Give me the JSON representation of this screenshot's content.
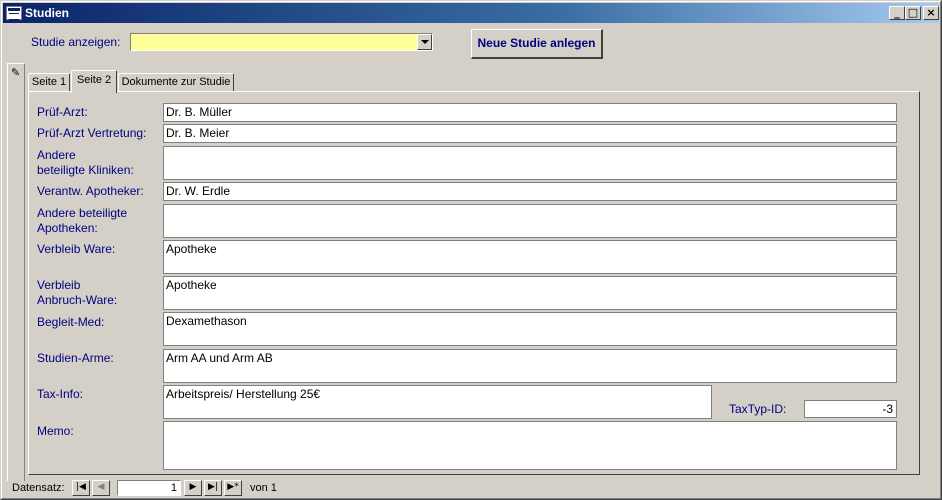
{
  "window": {
    "title": "Studien"
  },
  "titlebar_buttons": {
    "minimize": "_",
    "maximize": "□",
    "close": "×"
  },
  "header": {
    "studie_label": "Studie anzeigen:",
    "studie_value": "",
    "new_button": "Neue Studie anlegen"
  },
  "tabs": [
    {
      "label": "Seite 1"
    },
    {
      "label": "Seite 2",
      "active": true
    },
    {
      "label": "Dokumente zur Studie"
    }
  ],
  "fields": {
    "pruef_arzt": {
      "label": "Prüf-Arzt:",
      "value": "Dr. B. Müller"
    },
    "pruef_arzt_vertretung": {
      "label": "Prüf-Arzt Vertretung:",
      "value": "Dr. B. Meier"
    },
    "andere_kliniken": {
      "label1": "Andere",
      "label2": "beteiligte Kliniken:",
      "value": ""
    },
    "apotheker": {
      "label": "Verantw. Apotheker:",
      "value": "Dr. W. Erdle"
    },
    "andere_apotheken": {
      "label1": "Andere beteiligte",
      "label2": "Apotheken:",
      "value": ""
    },
    "verbleib_ware": {
      "label": "Verbleib Ware:",
      "value": "Apotheke"
    },
    "verbleib_anbruch": {
      "label1": "Verbleib",
      "label2": "Anbruch-Ware:",
      "value": "Apotheke"
    },
    "begleit_med": {
      "label": "Begleit-Med:",
      "value": "Dexamethason"
    },
    "studien_arme": {
      "label": "Studien-Arme:",
      "value": "Arm AA und Arm AB"
    },
    "tax_info": {
      "label": "Tax-Info:",
      "value": "Arbeitspreis/ Herstellung 25€"
    },
    "taxtyp_id": {
      "label": "TaxTyp-ID:",
      "value": "-3"
    },
    "memo": {
      "label": "Memo:",
      "value": ""
    }
  },
  "navigation": {
    "label": "Datensatz:",
    "record": "1",
    "of_text": "von  1",
    "first": "|◀",
    "prev": "◀",
    "next": "▶",
    "last": "▶|",
    "new": "▶*"
  },
  "colors": {
    "label": "#000080",
    "combo_bg": "#ffff99",
    "title_start": "#0a246a",
    "title_end": "#a6caf0"
  }
}
